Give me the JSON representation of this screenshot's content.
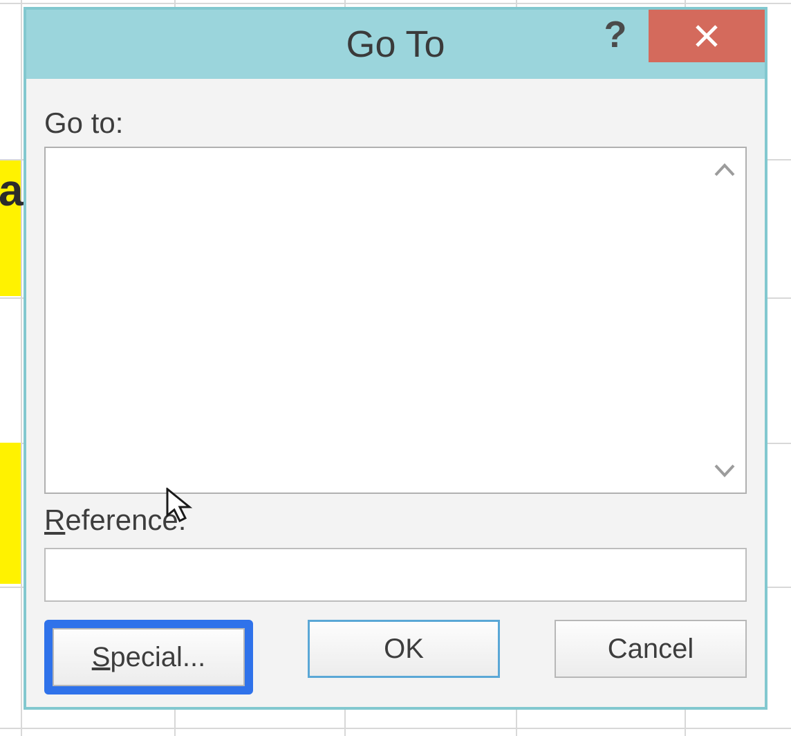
{
  "titlebar": {
    "title": "Go To",
    "help_char": "?"
  },
  "labels": {
    "goto": "Go to:",
    "reference_underline": "R",
    "reference_rest": "eference:"
  },
  "inputs": {
    "reference_value": ""
  },
  "buttons": {
    "special_underline": "S",
    "special_rest": "pecial...",
    "ok": "OK",
    "cancel": "Cancel"
  },
  "background": {
    "partial_cell_text": "a"
  }
}
